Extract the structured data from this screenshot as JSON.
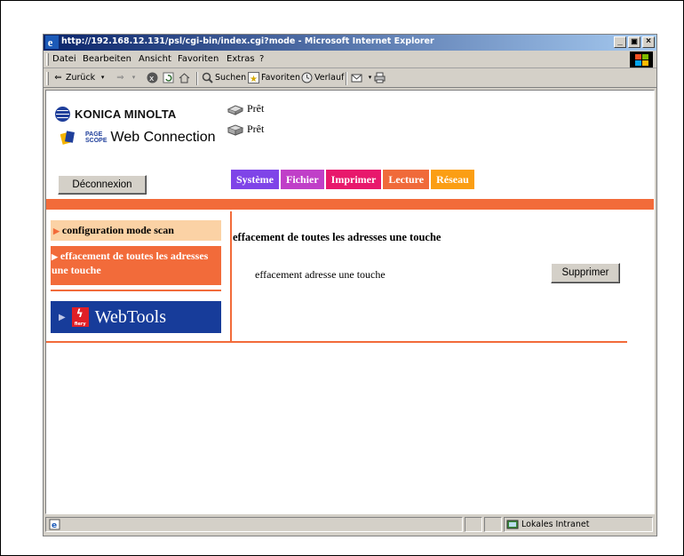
{
  "window": {
    "title": "http://192.168.12.131/psl/cgi-bin/index.cgi?mode - Microsoft Internet Explorer",
    "controls": [
      "_",
      "Đ",
      "×"
    ]
  },
  "menubar": {
    "items": [
      "Datei",
      "Bearbeiten",
      "Ansicht",
      "Favoriten",
      "Extras",
      "?"
    ]
  },
  "toolbar": {
    "back_label": "Zurück",
    "search_label": "Suchen",
    "favorites_label": "Favoriten",
    "history_label": "Verlauf"
  },
  "page": {
    "brand": "KONICA MINOLTA",
    "pagescope_small_1": "PAGE",
    "pagescope_small_2": "SCOPE",
    "product": "Web Connection",
    "status1": "Prêt",
    "status2": "Prêt",
    "logout_label": "Déconnexion",
    "tabs": [
      {
        "label": "Système",
        "color": "#7f44e8"
      },
      {
        "label": "Fichier",
        "color": "#c03fc8"
      },
      {
        "label": "Imprimer",
        "color": "#e8186c"
      },
      {
        "label": "Lecture",
        "color": "#f06a3a"
      },
      {
        "label": "Réseau",
        "color": "#fb9e14"
      }
    ],
    "accent_color": "#f26b3a"
  },
  "sidebar": {
    "item1": "configuration mode scan",
    "item2": "effacement de toutes les adresses une touche",
    "webtools_label": "WebTools",
    "fiery_text": "fiery"
  },
  "main": {
    "title": "effacement de toutes les adresses une touche",
    "row_label": "effacement adresse une touche",
    "delete_label": "Supprimer"
  },
  "statusbar": {
    "zone_label": "Lokales Intranet"
  }
}
